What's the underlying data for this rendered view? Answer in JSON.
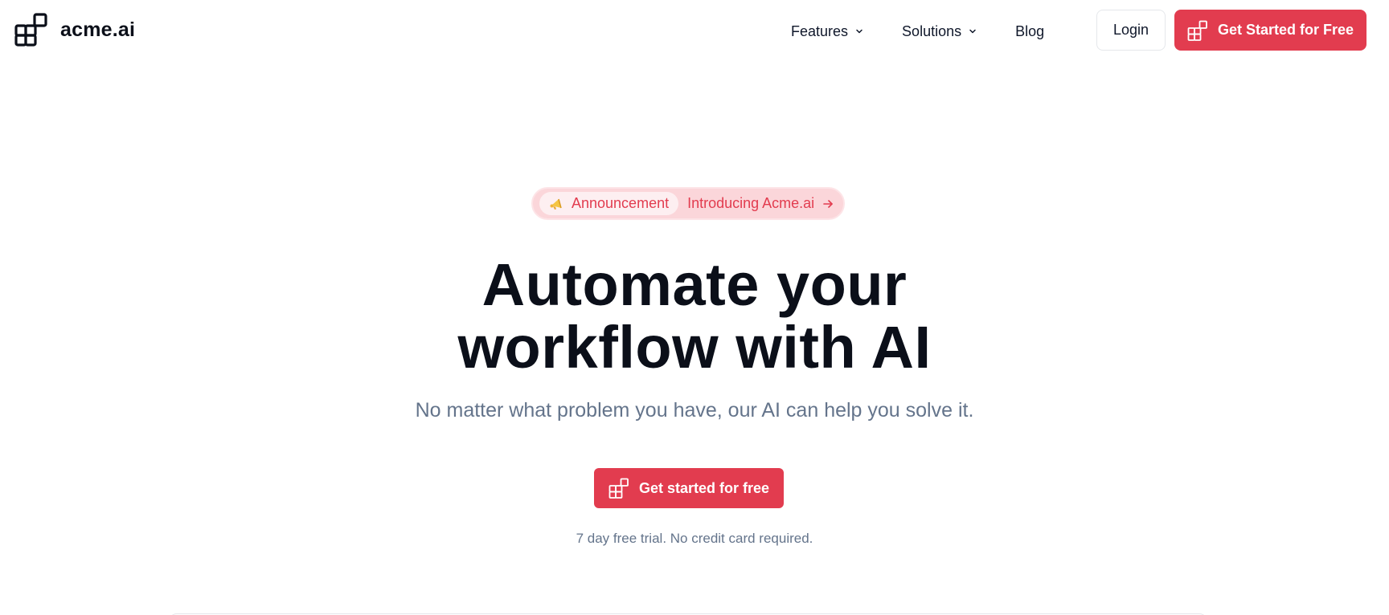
{
  "brand": {
    "logo_icon": "blocks-logo-icon",
    "name": "acme.ai"
  },
  "nav": {
    "items": [
      {
        "label": "Features",
        "has_dropdown": true
      },
      {
        "label": "Solutions",
        "has_dropdown": true
      },
      {
        "label": "Blog",
        "has_dropdown": false
      }
    ],
    "login_label": "Login",
    "cta_label": "Get Started for Free"
  },
  "announcement": {
    "badge_icon": "megaphone-icon",
    "badge_label": "Announcement",
    "text": "Introducing Acme.ai",
    "arrow_icon": "arrow-right-icon"
  },
  "hero": {
    "title_line1": "Automate your",
    "title_line2": "workflow with AI",
    "subtitle": "No matter what problem you have, our AI can help you solve it.",
    "cta_label": "Get started for free",
    "trial_note": "7 day free trial. No credit card required."
  },
  "colors": {
    "accent": "#e23c4f",
    "accent_soft": "#fbd6da",
    "text_dark": "#0b0f19",
    "text_muted": "#64748b",
    "border": "#e5e7eb"
  }
}
